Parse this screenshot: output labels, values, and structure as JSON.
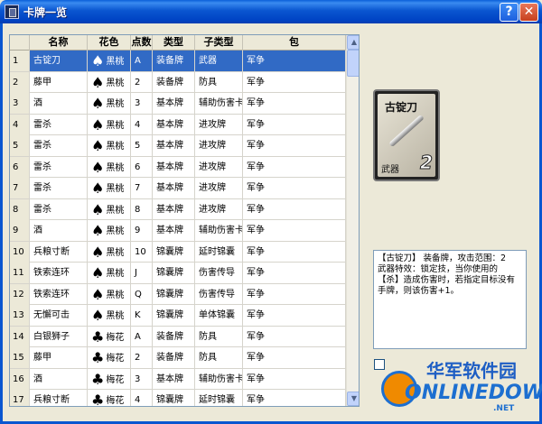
{
  "window": {
    "title": "卡牌一览",
    "help_label": "?",
    "close_label": "✕"
  },
  "table": {
    "columns": [
      "名称",
      "花色",
      "点数",
      "类型",
      "子类型",
      "包"
    ],
    "rows": [
      {
        "n": "1",
        "name": "古锭刀",
        "suit": "黑桃",
        "suit_icon": "♠",
        "point": "A",
        "type": "装备牌",
        "subtype": "武器",
        "pack": "军争",
        "selected": true
      },
      {
        "n": "2",
        "name": "藤甲",
        "suit": "黑桃",
        "suit_icon": "♠",
        "point": "2",
        "type": "装备牌",
        "subtype": "防具",
        "pack": "军争"
      },
      {
        "n": "3",
        "name": "酒",
        "suit": "黑桃",
        "suit_icon": "♠",
        "point": "3",
        "type": "基本牌",
        "subtype": "辅助伤害卡",
        "pack": "军争"
      },
      {
        "n": "4",
        "name": "雷杀",
        "suit": "黑桃",
        "suit_icon": "♠",
        "point": "4",
        "type": "基本牌",
        "subtype": "进攻牌",
        "pack": "军争"
      },
      {
        "n": "5",
        "name": "雷杀",
        "suit": "黑桃",
        "suit_icon": "♠",
        "point": "5",
        "type": "基本牌",
        "subtype": "进攻牌",
        "pack": "军争"
      },
      {
        "n": "6",
        "name": "雷杀",
        "suit": "黑桃",
        "suit_icon": "♠",
        "point": "6",
        "type": "基本牌",
        "subtype": "进攻牌",
        "pack": "军争"
      },
      {
        "n": "7",
        "name": "雷杀",
        "suit": "黑桃",
        "suit_icon": "♠",
        "point": "7",
        "type": "基本牌",
        "subtype": "进攻牌",
        "pack": "军争"
      },
      {
        "n": "8",
        "name": "雷杀",
        "suit": "黑桃",
        "suit_icon": "♠",
        "point": "8",
        "type": "基本牌",
        "subtype": "进攻牌",
        "pack": "军争"
      },
      {
        "n": "9",
        "name": "酒",
        "suit": "黑桃",
        "suit_icon": "♠",
        "point": "9",
        "type": "基本牌",
        "subtype": "辅助伤害卡",
        "pack": "军争"
      },
      {
        "n": "10",
        "name": "兵粮寸断",
        "suit": "黑桃",
        "suit_icon": "♠",
        "point": "10",
        "type": "锦囊牌",
        "subtype": "延时锦囊",
        "pack": "军争"
      },
      {
        "n": "11",
        "name": "铁索连环",
        "suit": "黑桃",
        "suit_icon": "♠",
        "point": "J",
        "type": "锦囊牌",
        "subtype": "伤害传导",
        "pack": "军争"
      },
      {
        "n": "12",
        "name": "铁索连环",
        "suit": "黑桃",
        "suit_icon": "♠",
        "point": "Q",
        "type": "锦囊牌",
        "subtype": "伤害传导",
        "pack": "军争"
      },
      {
        "n": "13",
        "name": "无懈可击",
        "suit": "黑桃",
        "suit_icon": "♠",
        "point": "K",
        "type": "锦囊牌",
        "subtype": "单体锦囊",
        "pack": "军争"
      },
      {
        "n": "14",
        "name": "白银狮子",
        "suit": "梅花",
        "suit_icon": "♣",
        "point": "A",
        "type": "装备牌",
        "subtype": "防具",
        "pack": "军争"
      },
      {
        "n": "15",
        "name": "藤甲",
        "suit": "梅花",
        "suit_icon": "♣",
        "point": "2",
        "type": "装备牌",
        "subtype": "防具",
        "pack": "军争"
      },
      {
        "n": "16",
        "name": "酒",
        "suit": "梅花",
        "suit_icon": "♣",
        "point": "3",
        "type": "基本牌",
        "subtype": "辅助伤害卡",
        "pack": "军争"
      },
      {
        "n": "17",
        "name": "兵粮寸断",
        "suit": "梅花",
        "suit_icon": "♣",
        "point": "4",
        "type": "锦囊牌",
        "subtype": "延时锦囊",
        "pack": "军争"
      }
    ]
  },
  "card": {
    "title": "古锭刀",
    "type": "武器",
    "number": "2"
  },
  "description": "【古锭刀】 装备牌，攻击范围：2\n武器特效：锁定技，当你使用的\n【杀】造成伤害时，若指定目标没有\n手牌，则该伤害+1。",
  "watermark": {
    "cn": "华军软件园",
    "en": "ONLINEDOWN",
    "net": ".NET"
  }
}
